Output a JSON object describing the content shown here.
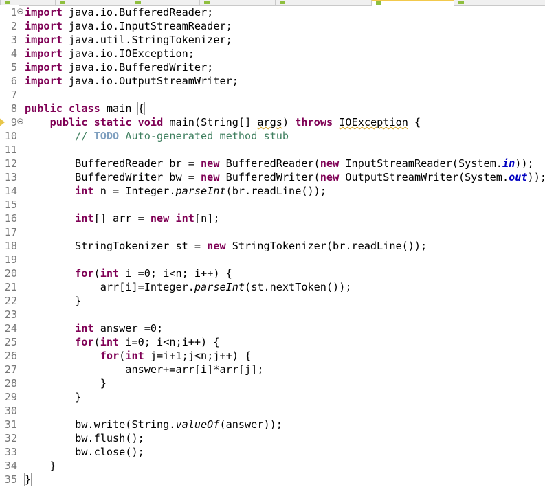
{
  "editor": {
    "lines": [
      {
        "n": "1",
        "fold": true,
        "seg": [
          {
            "c": "kw",
            "t": "import"
          },
          {
            "c": "",
            "t": " java.io.BufferedReader;"
          }
        ]
      },
      {
        "n": "2",
        "seg": [
          {
            "c": "kw",
            "t": "import"
          },
          {
            "c": "",
            "t": " java.io.InputStreamReader;"
          }
        ]
      },
      {
        "n": "3",
        "seg": [
          {
            "c": "kw",
            "t": "import"
          },
          {
            "c": "",
            "t": " java.util.StringTokenizer;"
          }
        ]
      },
      {
        "n": "4",
        "seg": [
          {
            "c": "kw",
            "t": "import"
          },
          {
            "c": "",
            "t": " java.io.IOException;"
          }
        ]
      },
      {
        "n": "5",
        "seg": [
          {
            "c": "kw",
            "t": "import"
          },
          {
            "c": "",
            "t": " java.io.BufferedWriter;"
          }
        ]
      },
      {
        "n": "6",
        "seg": [
          {
            "c": "kw",
            "t": "import"
          },
          {
            "c": "",
            "t": " java.io.OutputStreamWriter;"
          }
        ]
      },
      {
        "n": "7",
        "seg": []
      },
      {
        "n": "8",
        "seg": [
          {
            "c": "kw",
            "t": "public"
          },
          {
            "c": "",
            "t": " "
          },
          {
            "c": "kw",
            "t": "class"
          },
          {
            "c": "",
            "t": " main "
          },
          {
            "c": "box",
            "t": "{"
          }
        ]
      },
      {
        "n": "9",
        "fold": true,
        "marker": true,
        "seg": [
          {
            "c": "",
            "t": "    "
          },
          {
            "c": "kw",
            "t": "public"
          },
          {
            "c": "",
            "t": " "
          },
          {
            "c": "kw",
            "t": "static"
          },
          {
            "c": "",
            "t": " "
          },
          {
            "c": "kw",
            "t": "void"
          },
          {
            "c": "",
            "t": " main(String[] "
          },
          {
            "c": "warn",
            "t": "args"
          },
          {
            "c": "",
            "t": ") "
          },
          {
            "c": "kw",
            "t": "throws"
          },
          {
            "c": "",
            "t": " "
          },
          {
            "c": "warn",
            "t": "IOException"
          },
          {
            "c": "",
            "t": " {"
          }
        ]
      },
      {
        "n": "10",
        "seg": [
          {
            "c": "",
            "t": "        "
          },
          {
            "c": "cm",
            "t": "// "
          },
          {
            "c": "todo",
            "t": "TODO"
          },
          {
            "c": "cm",
            "t": " Auto-generated method stub"
          }
        ]
      },
      {
        "n": "11",
        "seg": []
      },
      {
        "n": "12",
        "seg": [
          {
            "c": "",
            "t": "        BufferedReader br = "
          },
          {
            "c": "kw",
            "t": "new"
          },
          {
            "c": "",
            "t": " BufferedReader("
          },
          {
            "c": "kw",
            "t": "new"
          },
          {
            "c": "",
            "t": " InputStreamReader(System."
          },
          {
            "c": "fld",
            "t": "in"
          },
          {
            "c": "",
            "t": "));"
          }
        ]
      },
      {
        "n": "13",
        "seg": [
          {
            "c": "",
            "t": "        BufferedWriter bw = "
          },
          {
            "c": "kw",
            "t": "new"
          },
          {
            "c": "",
            "t": " BufferedWriter("
          },
          {
            "c": "kw",
            "t": "new"
          },
          {
            "c": "",
            "t": " OutputStreamWriter(System."
          },
          {
            "c": "fld",
            "t": "out"
          },
          {
            "c": "",
            "t": "));"
          }
        ]
      },
      {
        "n": "14",
        "seg": [
          {
            "c": "",
            "t": "        "
          },
          {
            "c": "kw",
            "t": "int"
          },
          {
            "c": "",
            "t": " n = Integer."
          },
          {
            "c": "it",
            "t": "parseInt"
          },
          {
            "c": "",
            "t": "(br.readLine());"
          }
        ]
      },
      {
        "n": "15",
        "seg": []
      },
      {
        "n": "16",
        "seg": [
          {
            "c": "",
            "t": "        "
          },
          {
            "c": "kw",
            "t": "int"
          },
          {
            "c": "",
            "t": "[] arr = "
          },
          {
            "c": "kw",
            "t": "new"
          },
          {
            "c": "",
            "t": " "
          },
          {
            "c": "kw",
            "t": "int"
          },
          {
            "c": "",
            "t": "[n];"
          }
        ]
      },
      {
        "n": "17",
        "seg": []
      },
      {
        "n": "18",
        "seg": [
          {
            "c": "",
            "t": "        StringTokenizer st = "
          },
          {
            "c": "kw",
            "t": "new"
          },
          {
            "c": "",
            "t": " StringTokenizer(br.readLine());"
          }
        ]
      },
      {
        "n": "19",
        "seg": []
      },
      {
        "n": "20",
        "seg": [
          {
            "c": "",
            "t": "        "
          },
          {
            "c": "kw",
            "t": "for"
          },
          {
            "c": "",
            "t": "("
          },
          {
            "c": "kw",
            "t": "int"
          },
          {
            "c": "",
            "t": " i =0; i<n; i++) {"
          }
        ]
      },
      {
        "n": "21",
        "seg": [
          {
            "c": "",
            "t": "            arr[i]=Integer."
          },
          {
            "c": "it",
            "t": "parseInt"
          },
          {
            "c": "",
            "t": "(st.nextToken());"
          }
        ]
      },
      {
        "n": "22",
        "seg": [
          {
            "c": "",
            "t": "        }"
          }
        ]
      },
      {
        "n": "23",
        "seg": []
      },
      {
        "n": "24",
        "seg": [
          {
            "c": "",
            "t": "        "
          },
          {
            "c": "kw",
            "t": "int"
          },
          {
            "c": "",
            "t": " answer =0;"
          }
        ]
      },
      {
        "n": "25",
        "seg": [
          {
            "c": "",
            "t": "        "
          },
          {
            "c": "kw",
            "t": "for"
          },
          {
            "c": "",
            "t": "("
          },
          {
            "c": "kw",
            "t": "int"
          },
          {
            "c": "",
            "t": " i=0; i<n;i++) {"
          }
        ]
      },
      {
        "n": "26",
        "seg": [
          {
            "c": "",
            "t": "            "
          },
          {
            "c": "kw",
            "t": "for"
          },
          {
            "c": "",
            "t": "("
          },
          {
            "c": "kw",
            "t": "int"
          },
          {
            "c": "",
            "t": " j=i+1;j<n;j++) {"
          }
        ]
      },
      {
        "n": "27",
        "seg": [
          {
            "c": "",
            "t": "                answer+=arr[i]*arr[j];"
          }
        ]
      },
      {
        "n": "28",
        "seg": [
          {
            "c": "",
            "t": "            }"
          }
        ]
      },
      {
        "n": "29",
        "seg": [
          {
            "c": "",
            "t": "        }"
          }
        ]
      },
      {
        "n": "30",
        "seg": []
      },
      {
        "n": "31",
        "seg": [
          {
            "c": "",
            "t": "        bw.write(String."
          },
          {
            "c": "it",
            "t": "valueOf"
          },
          {
            "c": "",
            "t": "(answer));"
          }
        ]
      },
      {
        "n": "32",
        "seg": [
          {
            "c": "",
            "t": "        bw.flush();"
          }
        ]
      },
      {
        "n": "33",
        "seg": [
          {
            "c": "",
            "t": "        bw.close();"
          }
        ]
      },
      {
        "n": "34",
        "seg": [
          {
            "c": "",
            "t": "    }"
          }
        ]
      },
      {
        "n": "35",
        "caret": true,
        "seg": [
          {
            "c": "box",
            "t": "}"
          }
        ]
      }
    ]
  },
  "colors": {
    "keyword": "#7f0055",
    "comment": "#3f7f5f",
    "todo": "#7f9fbf",
    "field": "#0000c0",
    "line_number": "#787878",
    "warning_underline": "#d4a017"
  },
  "icons": [
    "fold-collapse-icon",
    "override-marker-icon"
  ]
}
